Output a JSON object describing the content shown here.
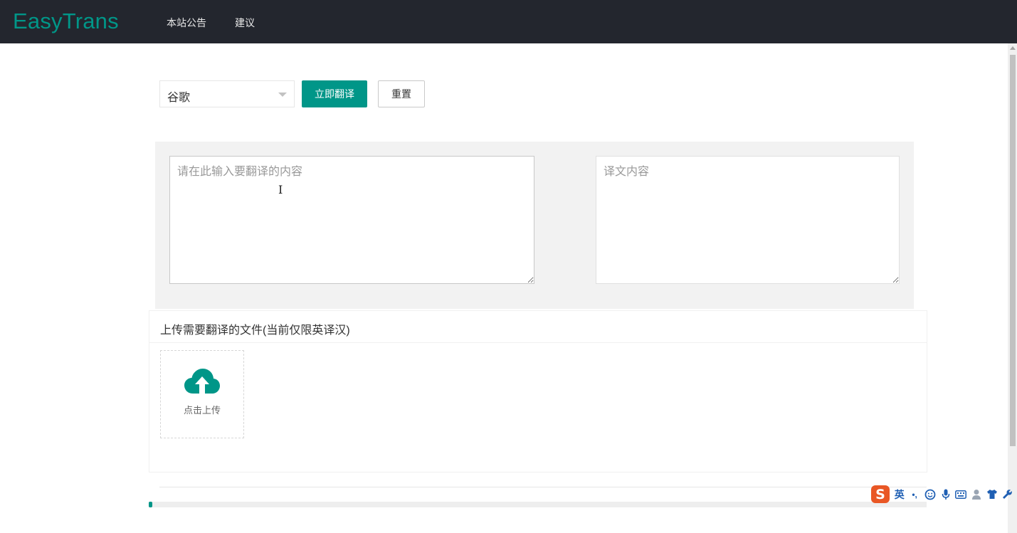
{
  "header": {
    "brand": "EasyTrans",
    "nav": [
      "本站公告",
      "建议"
    ]
  },
  "toolbar": {
    "engine_selected": "谷歌",
    "translate_label": "立即翻译",
    "reset_label": "重置"
  },
  "translator": {
    "source_placeholder": "请在此输入要翻译的内容",
    "target_placeholder": "译文内容",
    "source_value": "",
    "target_value": ""
  },
  "upload": {
    "title": "上传需要翻译的文件(当前仅限英译汉)",
    "button_label": "点击上传"
  },
  "progress": {
    "percent": 0.5
  },
  "ime": {
    "logo": "S",
    "mode": "英",
    "punct": "•,",
    "icons": [
      "smiley-icon",
      "microphone-icon",
      "keyboard-icon",
      "user-icon",
      "shirt-icon",
      "wrench-icon"
    ]
  },
  "colors": {
    "accent": "#009688",
    "header_bg": "#23262e",
    "ime_brand": "#e95725"
  }
}
